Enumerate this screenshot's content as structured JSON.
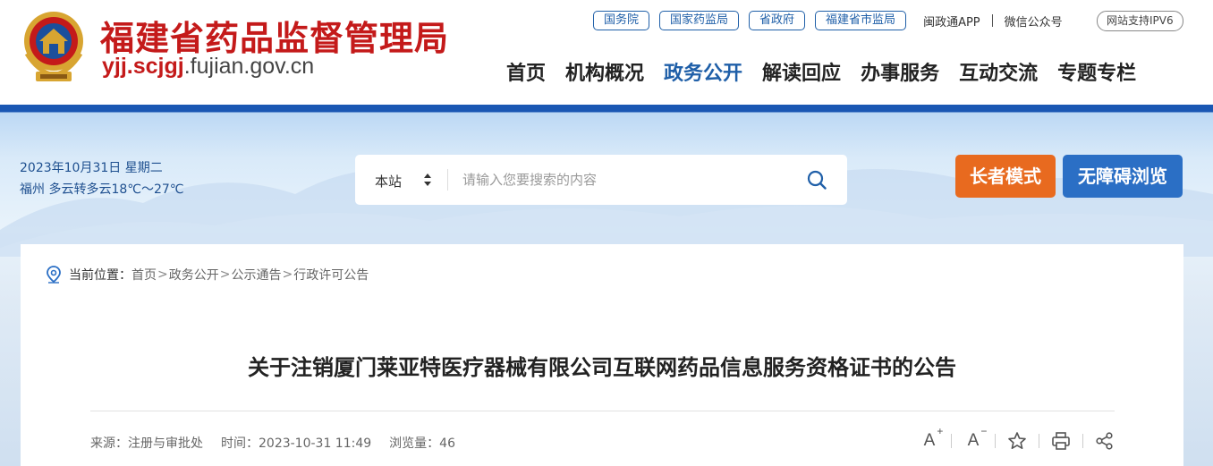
{
  "header": {
    "site_title": "福建省药品监督管理局",
    "domain_red": "yjj.scjgj",
    "domain_grey": ".fujian.gov.cn",
    "top_links": [
      "国务院",
      "国家药监局",
      "省政府",
      "福建省市监局"
    ],
    "app_link": "闽政通APP",
    "wechat_link": "微信公众号",
    "ipv6": "网站支持IPV6",
    "nav": [
      {
        "label": "首页",
        "active": false
      },
      {
        "label": "机构概况",
        "active": false
      },
      {
        "label": "政务公开",
        "active": true
      },
      {
        "label": "解读回应",
        "active": false
      },
      {
        "label": "办事服务",
        "active": false
      },
      {
        "label": "互动交流",
        "active": false
      },
      {
        "label": "专题专栏",
        "active": false
      }
    ]
  },
  "banner": {
    "date": "2023年10月31日 星期二",
    "weather": "福州 多云转多云18℃～27℃",
    "search": {
      "scope": "本站",
      "placeholder": "请输入您要搜索的内容",
      "value": ""
    },
    "elder_mode": "长者模式",
    "accessible": "无障碍浏览"
  },
  "breadcrumb": {
    "label": "当前位置：",
    "items": [
      "首页",
      "政务公开",
      "公示通告",
      "行政许可公告"
    ],
    "separator": ">"
  },
  "article": {
    "title": "关于注销厦门莱亚特医疗器械有限公司互联网药品信息服务资格证书的公告",
    "source": "来源：注册与审批处",
    "time": "时间：2023-10-31 11:49",
    "views": "浏览量：46"
  },
  "tools": {
    "font_larger": "A",
    "font_larger_sign": "+",
    "font_smaller": "A",
    "font_smaller_sign": "−"
  },
  "colors": {
    "brand_red": "#c41a1a",
    "brand_blue": "#1f5fa8",
    "elder_orange": "#e86a1f",
    "access_blue": "#2b6fc5"
  }
}
